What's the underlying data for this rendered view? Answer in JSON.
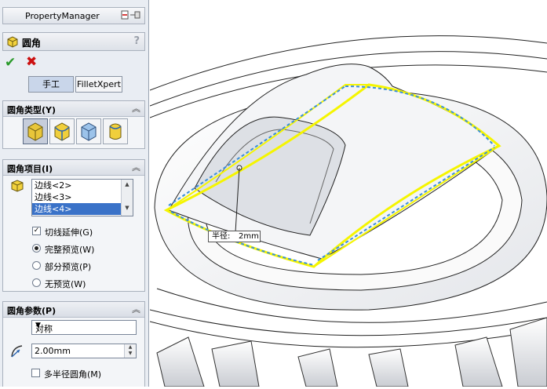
{
  "property_manager": {
    "title": "PropertyManager",
    "feature_title": "圆角",
    "help": "?",
    "tabs": [
      "手工",
      "FilletXpert"
    ],
    "fillet_type": {
      "header": "圆角类型(Y)",
      "options": [
        "constant-size",
        "variable-size",
        "face",
        "full-round"
      ],
      "selected": 0
    },
    "fillet_items": {
      "header": "圆角项目(I)",
      "edges": [
        "边线<2>",
        "边线<3>",
        "边线<4>"
      ],
      "selected_edge": "边线<4>",
      "tangent_propagation_label": "切线延伸(G)",
      "tangent_propagation": true,
      "preview_options": [
        "完整预览(W)",
        "部分预览(P)",
        "无预览(W)"
      ],
      "preview_selected": "完整预览(W)"
    },
    "fillet_params": {
      "header": "圆角参数(P)",
      "method": "对称",
      "radius": "2.00mm",
      "multi_radius_label": "多半径圆角(M)",
      "multi_radius": false
    }
  },
  "viewport": {
    "radius_callout_label": "半径:",
    "radius_callout_value": "2mm"
  },
  "colors": {
    "selection_yellow": "#f5f500",
    "highlight_blue": "#3a8fd8",
    "panel_bg": "#e9edf3"
  }
}
